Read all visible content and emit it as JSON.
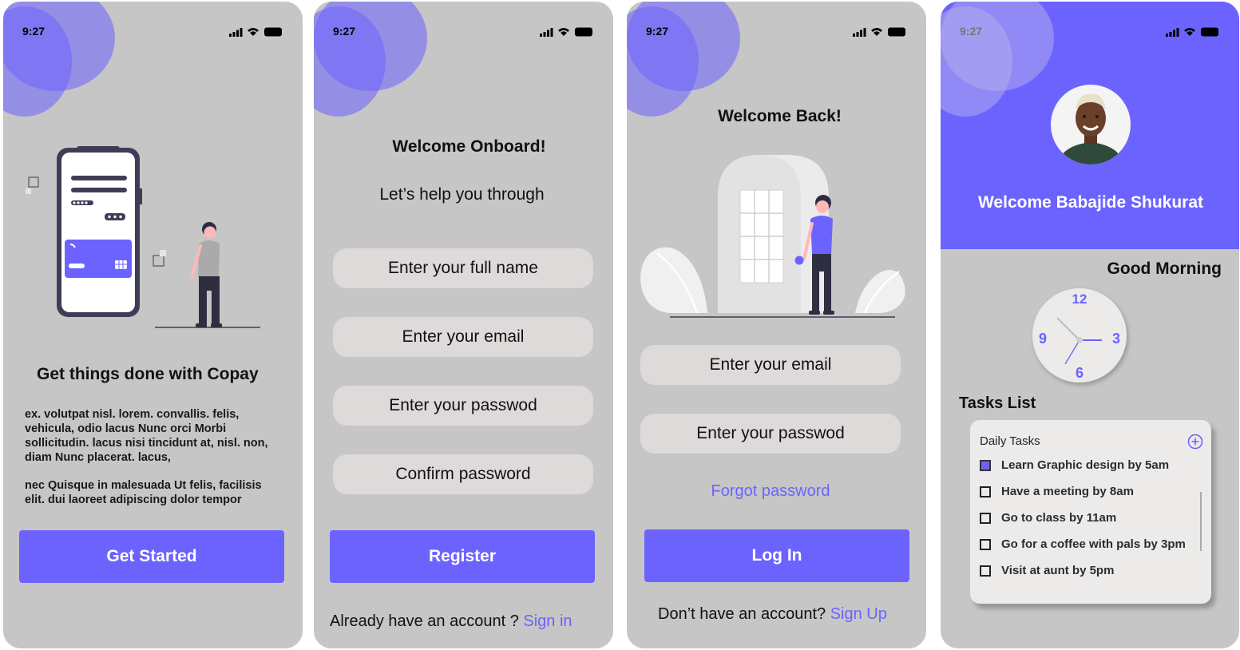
{
  "status": {
    "time": "9:27"
  },
  "onboarding": {
    "title": "Get things done with Copay",
    "paragraph1": "ex. volutpat nisl. lorem. convallis. felis, vehicula, odio lacus Nunc orci Morbi sollicitudin. lacus nisi tincidunt at, nisl. non, diam Nunc placerat. lacus,",
    "paragraph2": "nec Quisque in malesuada Ut felis, facilisis elit. dui laoreet adipiscing dolor tempor",
    "button": "Get Started"
  },
  "register": {
    "title": "Welcome Onboard!",
    "subtitle": "Let’s  help you through",
    "fullname_placeholder": "Enter your full name",
    "email_placeholder": "Enter your email",
    "password_placeholder": "Enter your passwod",
    "confirm_placeholder": "Confirm password",
    "button": "Register",
    "footer_text": "Already have an account ? ",
    "footer_link": "Sign in"
  },
  "login": {
    "title": "Welcome Back!",
    "email_placeholder": "Enter your email",
    "password_placeholder": "Enter your passwod",
    "forgot": "Forgot password",
    "button": "Log In",
    "footer_text": "Don’t have an  account? ",
    "footer_link": "Sign Up"
  },
  "dashboard": {
    "welcome": "Welcome Babajide Shukurat",
    "greeting": "Good Morning",
    "clock": {
      "n12": "12",
      "n3": "3",
      "n6": "6",
      "n9": "9"
    },
    "tasks_heading": "Tasks List",
    "card_title": "Daily Tasks",
    "tasks": [
      {
        "label": "Learn Graphic design by 5am",
        "done": true
      },
      {
        "label": "Have a meeting by 8am",
        "done": false
      },
      {
        "label": "Go to class by 11am",
        "done": false
      },
      {
        "label": "Go for a coffee with pals by 3pm",
        "done": false
      },
      {
        "label": "Visit at aunt by 5pm",
        "done": false
      }
    ]
  },
  "colors": {
    "accent": "#6c63ff",
    "screen_bg": "#c6c6c6",
    "field_bg": "#dedad9"
  },
  "icons": [
    "signal-icon",
    "wifi-icon",
    "battery-icon",
    "add-task-icon",
    "checkbox-icon"
  ]
}
